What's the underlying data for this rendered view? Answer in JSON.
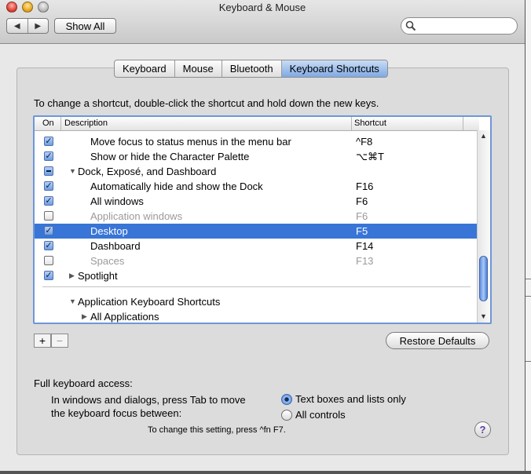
{
  "window": {
    "title": "Keyboard & Mouse"
  },
  "toolbar": {
    "back_glyph": "◀",
    "forward_glyph": "▶",
    "show_all_label": "Show All",
    "search_placeholder": ""
  },
  "tabs": [
    {
      "label": "Keyboard",
      "active": false
    },
    {
      "label": "Mouse",
      "active": false
    },
    {
      "label": "Bluetooth",
      "active": false
    },
    {
      "label": "Keyboard Shortcuts",
      "active": true
    }
  ],
  "instructions": "To change a shortcut, double-click the shortcut and hold down the new keys.",
  "table": {
    "columns": {
      "on": "On",
      "description": "Description",
      "shortcut": "Shortcut"
    },
    "rows": [
      {
        "state": "on",
        "indent": 2,
        "description": "Move focus to status menus in the menu bar",
        "shortcut": "^F8"
      },
      {
        "state": "on",
        "indent": 2,
        "description": "Show or hide the Character Palette",
        "shortcut": "⌥⌘T"
      },
      {
        "state": "mixed",
        "indent": 1,
        "expander": "▼",
        "description": "Dock, Exposé, and Dashboard",
        "shortcut": ""
      },
      {
        "state": "on",
        "indent": 2,
        "description": "Automatically hide and show the Dock",
        "shortcut": "F16"
      },
      {
        "state": "on",
        "indent": 2,
        "description": "All windows",
        "shortcut": "F6"
      },
      {
        "state": "off",
        "indent": 2,
        "dim": true,
        "description": "Application windows",
        "shortcut": "F6"
      },
      {
        "state": "on",
        "indent": 2,
        "selected": true,
        "description": "Desktop",
        "shortcut": "F5"
      },
      {
        "state": "on",
        "indent": 2,
        "description": "Dashboard",
        "shortcut": "F14"
      },
      {
        "state": "off",
        "indent": 2,
        "dim": true,
        "description": "Spaces",
        "shortcut": "F13"
      },
      {
        "state": "on",
        "indent": 1,
        "expander": "▶",
        "description": "Spotlight",
        "shortcut": ""
      }
    ],
    "app_rows": [
      {
        "expander": "▼",
        "description": "Application Keyboard Shortcuts"
      },
      {
        "expander": "▶",
        "description": "All Applications"
      }
    ]
  },
  "buttons": {
    "add": "+",
    "remove": "−",
    "restore_defaults": "Restore Defaults"
  },
  "keyboard_access": {
    "heading": "Full keyboard access:",
    "help_line1": "In windows and dialogs, press Tab to move",
    "help_line2": "the keyboard focus between:",
    "options": [
      {
        "label": "Text boxes and lists only",
        "selected": true
      },
      {
        "label": "All controls",
        "selected": false
      }
    ],
    "note": "To change this setting, press ^fn F7."
  },
  "help_button": "?"
}
